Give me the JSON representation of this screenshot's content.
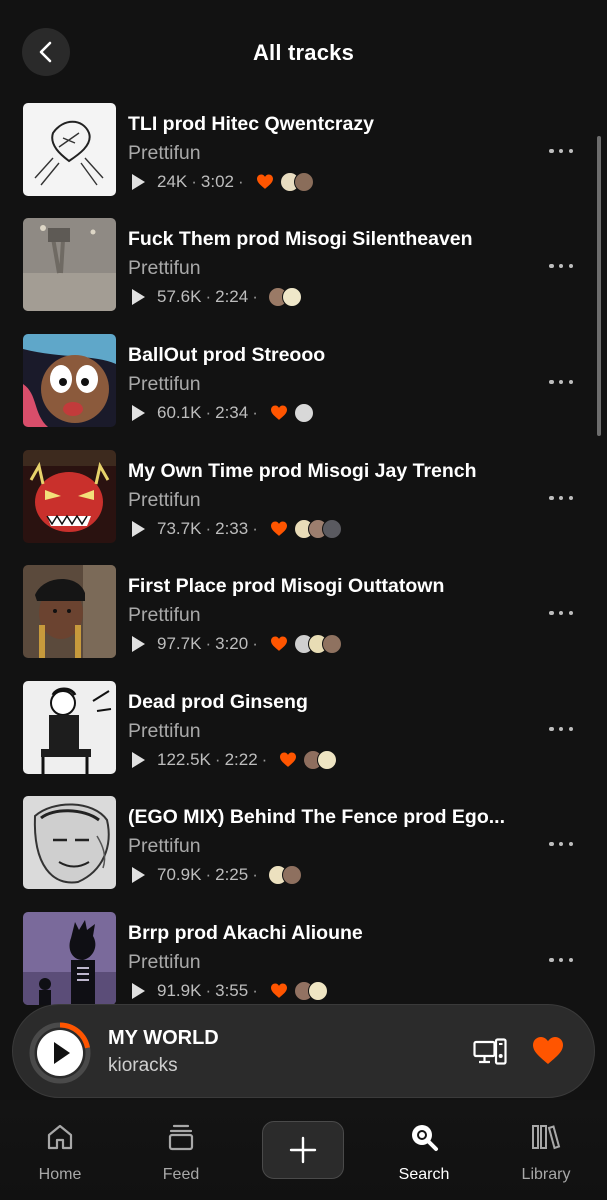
{
  "header": {
    "title": "All tracks",
    "back_icon": "chevron-left-icon"
  },
  "tracks": [
    {
      "title": "TLI prod Hitec Qwentcrazy",
      "artist": "Prettifun",
      "plays": "24K",
      "duration": "3:02",
      "liked": true,
      "avatars": [
        "#e8dcc0",
        "#8a6d5a"
      ],
      "art": "sketch-hands"
    },
    {
      "title": "Fuck Them prod Misogi Silentheaven",
      "artist": "Prettifun",
      "plays": "57.6K",
      "duration": "2:24",
      "liked": false,
      "avatars": [
        "#9a7a66",
        "#efe7c9"
      ],
      "art": "grey-photo"
    },
    {
      "title": "BallOut prod Streooo",
      "artist": "Prettifun",
      "plays": "60.1K",
      "duration": "2:34",
      "liked": true,
      "avatars": [
        "#d8d8d8"
      ],
      "art": "cartoon-face"
    },
    {
      "title": "My Own Time prod Misogi Jay Trench",
      "artist": "Prettifun",
      "plays": "73.7K",
      "duration": "2:33",
      "liked": true,
      "avatars": [
        "#e9dcb8",
        "#9c7e6e",
        "#5a5a60"
      ],
      "art": "red-demon"
    },
    {
      "title": "First Place prod Misogi Outtatown",
      "artist": "Prettifun",
      "plays": "97.7K",
      "duration": "3:20",
      "liked": true,
      "avatars": [
        "#cfcfcf",
        "#e8ddb5",
        "#8f7260"
      ],
      "art": "selfie"
    },
    {
      "title": "Dead prod Ginseng",
      "artist": "Prettifun",
      "plays": "122.5K",
      "duration": "2:22",
      "liked": true,
      "avatars": [
        "#8e6e5e",
        "#eee4c2"
      ],
      "art": "manga"
    },
    {
      "title": "(EGO MIX) Behind The Fence prod Ego...",
      "artist": "Prettifun",
      "plays": "70.9K",
      "duration": "2:25",
      "liked": false,
      "avatars": [
        "#ece1bf",
        "#8e705f"
      ],
      "art": "sketch-face"
    },
    {
      "title": "Brrp prod Akachi Alioune",
      "artist": "Prettifun",
      "plays": "91.9K",
      "duration": "3:55",
      "liked": true,
      "avatars": [
        "#927262",
        "#efe5c3"
      ],
      "art": "purple-figure"
    }
  ],
  "mini_player": {
    "title": "MY WORLD",
    "artist": "kioracks",
    "progress": 0.22,
    "accent": "#ff5500",
    "liked": true
  },
  "nav": [
    {
      "label": "Home",
      "icon": "home-icon",
      "active": false
    },
    {
      "label": "Feed",
      "icon": "feed-icon",
      "active": false
    },
    {
      "label": "",
      "icon": "plus-icon",
      "active": false
    },
    {
      "label": "Search",
      "icon": "search-icon",
      "active": true
    },
    {
      "label": "Library",
      "icon": "library-icon",
      "active": false
    }
  ],
  "colors": {
    "background": "#121212",
    "accent": "#ff5500",
    "muted_text": "#a9a9a9"
  }
}
